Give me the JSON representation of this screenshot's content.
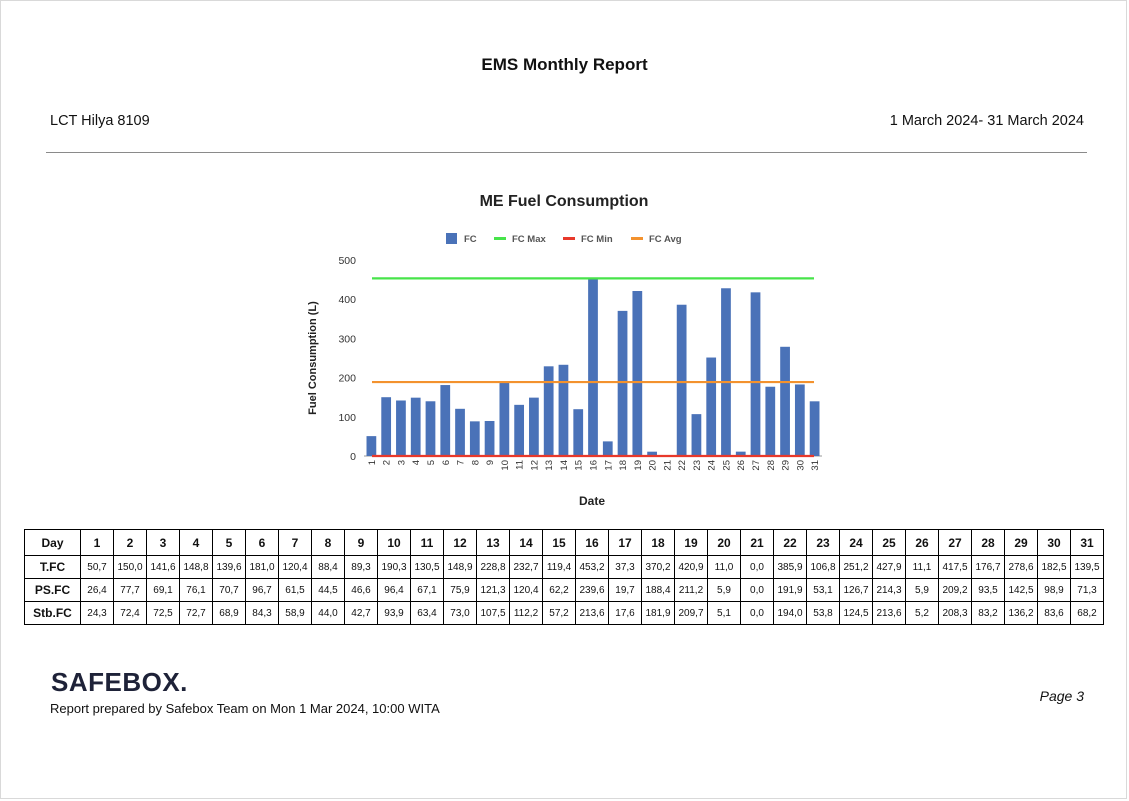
{
  "report": {
    "title": "EMS Monthly Report",
    "vessel": "LCT Hilya 8109",
    "period": "1 March 2024- 31 March 2024"
  },
  "chart_data": {
    "type": "bar",
    "title": "ME Fuel Consumption",
    "xlabel": "Date",
    "ylabel": "Fuel Consumption (L)",
    "ylim": [
      0,
      500
    ],
    "yticks": [
      0,
      100,
      200,
      300,
      400,
      500
    ],
    "grid": false,
    "legend_position": "top",
    "categories": [
      "1",
      "2",
      "3",
      "4",
      "5",
      "6",
      "7",
      "8",
      "9",
      "10",
      "11",
      "12",
      "13",
      "14",
      "15",
      "16",
      "17",
      "18",
      "19",
      "20",
      "21",
      "22",
      "23",
      "24",
      "25",
      "26",
      "27",
      "28",
      "29",
      "30",
      "31"
    ],
    "series": [
      {
        "name": "FC",
        "type": "bar",
        "color": "#4a72b8",
        "values": [
          50.7,
          150.0,
          141.6,
          148.8,
          139.6,
          181.0,
          120.4,
          88.4,
          89.3,
          190.3,
          130.5,
          148.9,
          228.8,
          232.7,
          119.4,
          453.2,
          37.3,
          370.2,
          420.9,
          11.0,
          0.0,
          385.9,
          106.8,
          251.2,
          427.9,
          11.1,
          417.5,
          176.7,
          278.6,
          182.5,
          139.5
        ]
      },
      {
        "name": "FC Max",
        "type": "line",
        "color": "#47e44a",
        "value": 453.2
      },
      {
        "name": "FC Min",
        "type": "line",
        "color": "#e8392b",
        "value": 0.0
      },
      {
        "name": "FC Avg",
        "type": "line",
        "color": "#f3922e",
        "value": 188.6
      }
    ]
  },
  "table": {
    "rows": [
      {
        "label": "Day",
        "values": [
          "1",
          "2",
          "3",
          "4",
          "5",
          "6",
          "7",
          "8",
          "9",
          "10",
          "11",
          "12",
          "13",
          "14",
          "15",
          "16",
          "17",
          "18",
          "19",
          "20",
          "21",
          "22",
          "23",
          "24",
          "25",
          "26",
          "27",
          "28",
          "29",
          "30",
          "31"
        ]
      },
      {
        "label": "T.FC",
        "values": [
          "50,7",
          "150,0",
          "141,6",
          "148,8",
          "139,6",
          "181,0",
          "120,4",
          "88,4",
          "89,3",
          "190,3",
          "130,5",
          "148,9",
          "228,8",
          "232,7",
          "119,4",
          "453,2",
          "37,3",
          "370,2",
          "420,9",
          "11,0",
          "0,0",
          "385,9",
          "106,8",
          "251,2",
          "427,9",
          "11,1",
          "417,5",
          "176,7",
          "278,6",
          "182,5",
          "139,5"
        ]
      },
      {
        "label": "PS.FC",
        "values": [
          "26,4",
          "77,7",
          "69,1",
          "76,1",
          "70,7",
          "96,7",
          "61,5",
          "44,5",
          "46,6",
          "96,4",
          "67,1",
          "75,9",
          "121,3",
          "120,4",
          "62,2",
          "239,6",
          "19,7",
          "188,4",
          "211,2",
          "5,9",
          "0,0",
          "191,9",
          "53,1",
          "126,7",
          "214,3",
          "5,9",
          "209,2",
          "93,5",
          "142,5",
          "98,9",
          "71,3"
        ]
      },
      {
        "label": "Stb.FC",
        "values": [
          "24,3",
          "72,4",
          "72,5",
          "72,7",
          "68,9",
          "84,3",
          "58,9",
          "44,0",
          "42,7",
          "93,9",
          "63,4",
          "73,0",
          "107,5",
          "112,2",
          "57,2",
          "213,6",
          "17,6",
          "181,9",
          "209,7",
          "5,1",
          "0,0",
          "194,0",
          "53,8",
          "124,5",
          "213,6",
          "5,2",
          "208,3",
          "83,2",
          "136,2",
          "83,6",
          "68,2"
        ]
      }
    ]
  },
  "footer": {
    "brand": "SAFEBOX.",
    "prepared": "Report prepared by Safebox Team on Mon 1 Mar 2024, 10:00 WITA",
    "page": "Page 3"
  }
}
